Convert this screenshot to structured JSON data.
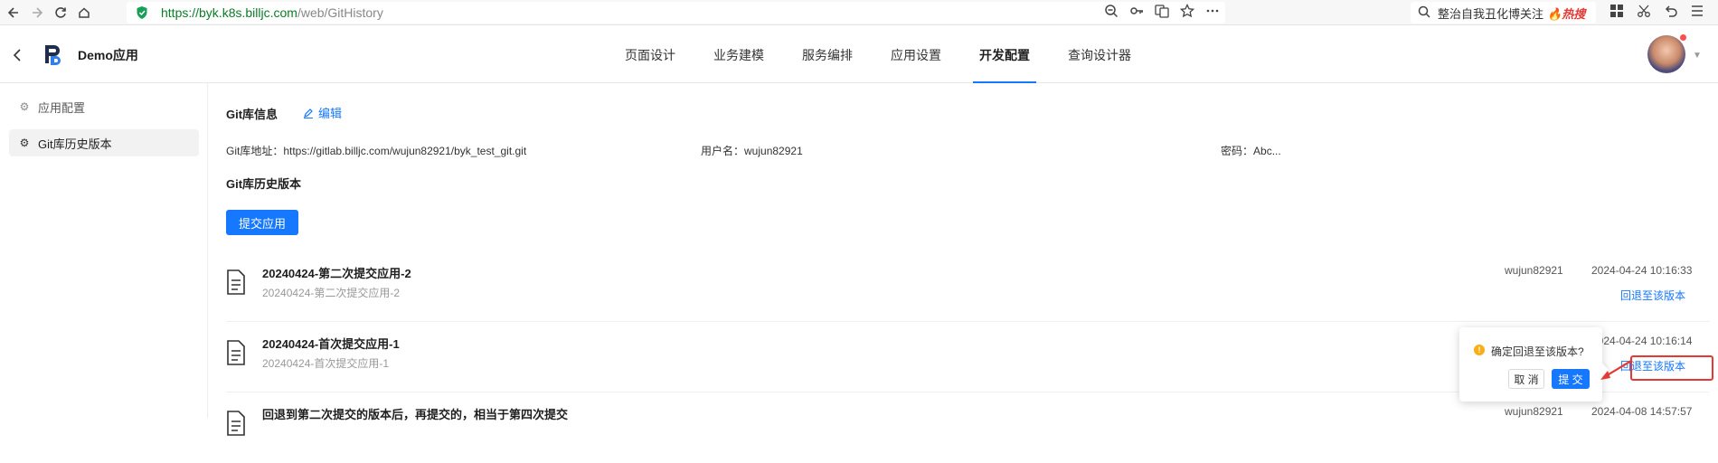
{
  "browser": {
    "url_host": "https://byk.k8s.billjc.com",
    "url_path": "/web/GitHistory",
    "search_text": "整治自我丑化博关注",
    "search_hot": "热搜"
  },
  "app": {
    "name": "Demo应用",
    "nav": [
      "页面设计",
      "业务建模",
      "服务编排",
      "应用设置",
      "开发配置",
      "查询设计器"
    ],
    "active_nav": "开发配置"
  },
  "sidebar": {
    "items": [
      {
        "label": "应用配置",
        "icon": "gear-icon"
      },
      {
        "label": "Git库历史版本",
        "icon": "gear-icon"
      }
    ]
  },
  "git_info": {
    "title": "Git库信息",
    "edit_label": "编辑",
    "address_label": "Git库地址：",
    "address_value": "https://gitlab.billjc.com/wujun82921/byk_test_git.git",
    "username_label": "用户名：",
    "username_value": "wujun82921",
    "password_label": "密码：",
    "password_value": "Abc..."
  },
  "history": {
    "title": "Git库历史版本",
    "submit_label": "提交应用",
    "rows": [
      {
        "title": "20240424-第二次提交应用-2",
        "sub": "20240424-第二次提交应用-2",
        "user": "wujun82921",
        "time": "2024-04-24 10:16:33",
        "action": "回退至该版本"
      },
      {
        "title": "20240424-首次提交应用-1",
        "sub": "20240424-首次提交应用-1",
        "user": "",
        "time": "2024-04-24 10:16:14",
        "action": "回退至该版本"
      },
      {
        "title": "回退到第二次提交的版本后，再提交的，相当于第四次提交",
        "sub": "",
        "user": "wujun82921",
        "time": "2024-04-08 14:57:57",
        "action": ""
      }
    ]
  },
  "popconfirm": {
    "message": "确定回退至该版本?",
    "cancel_label": "取 消",
    "ok_label": "提 交"
  },
  "colors": {
    "primary": "#1677ff",
    "annotation": "#e53935",
    "warning": "#faad14"
  }
}
